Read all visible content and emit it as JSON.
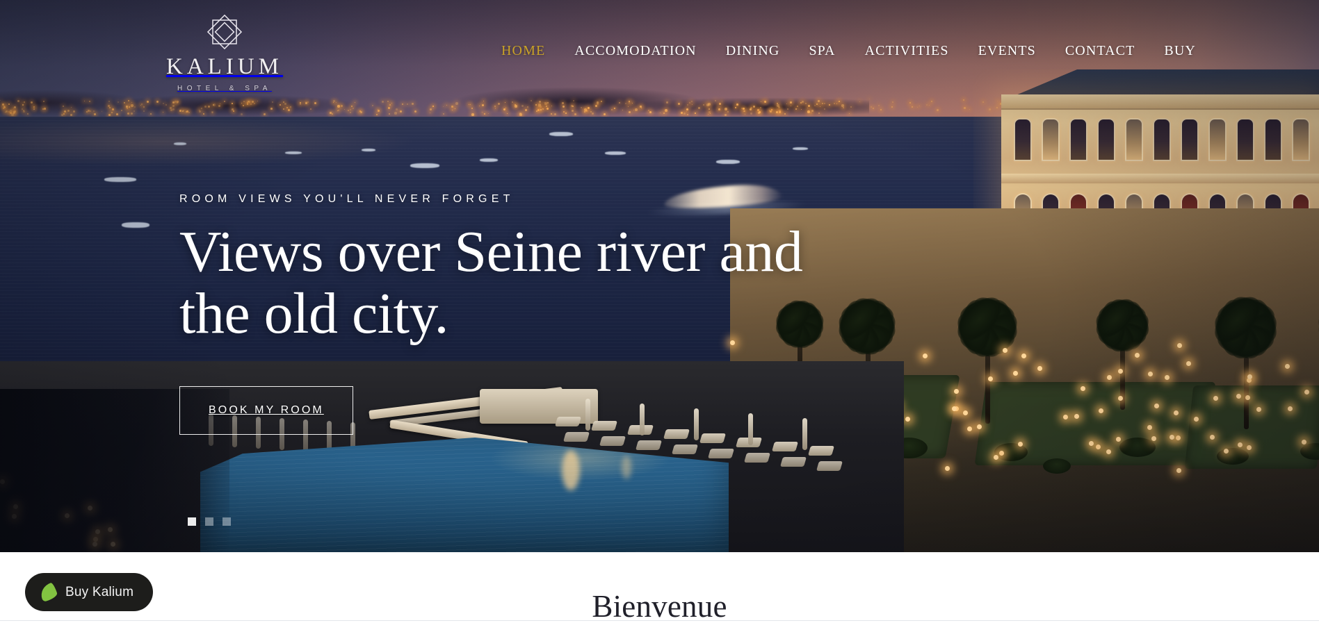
{
  "site": {
    "brand_name": "KALIUM",
    "brand_tagline": "HOTEL & SPA",
    "logo_icon": "octagram-star-logo-icon"
  },
  "nav": {
    "active_index": 0,
    "items": [
      {
        "label": "HOME",
        "active": true
      },
      {
        "label": "ACCOMODATION",
        "active": false
      },
      {
        "label": "DINING",
        "active": false
      },
      {
        "label": "SPA",
        "active": false
      },
      {
        "label": "ACTIVITIES",
        "active": false
      },
      {
        "label": "EVENTS",
        "active": false
      },
      {
        "label": "CONTACT",
        "active": false
      },
      {
        "label": "BUY",
        "active": false
      }
    ]
  },
  "hero": {
    "eyebrow": "ROOM VIEWS YOU'LL NEVER FORGET",
    "headline_line1": "Views over Seine river and",
    "headline_line2": "the old city.",
    "cta_label": "BOOK MY ROOM",
    "background_description": "Twilight panorama of a waterfront Ottoman palace hotel with an illuminated swimming pool, palm trees and a city skyline across the water",
    "slides_total": 3,
    "slide_active": 1
  },
  "footer_bar": {
    "buy_label": "Buy Kalium",
    "buy_icon": "leaf-icon"
  },
  "welcome": {
    "title": "Bienvenue"
  },
  "colors": {
    "accent_gold": "#c9a227",
    "text_on_hero": "#ffffff",
    "badge_background": "#1d1d1b",
    "leaf_green": "#82c341",
    "welcome_text": "#20202a",
    "sky_left": "#474b6c",
    "sky_right": "#bb8374",
    "water": "#1f2847",
    "pool_blue": "#2a648f"
  }
}
